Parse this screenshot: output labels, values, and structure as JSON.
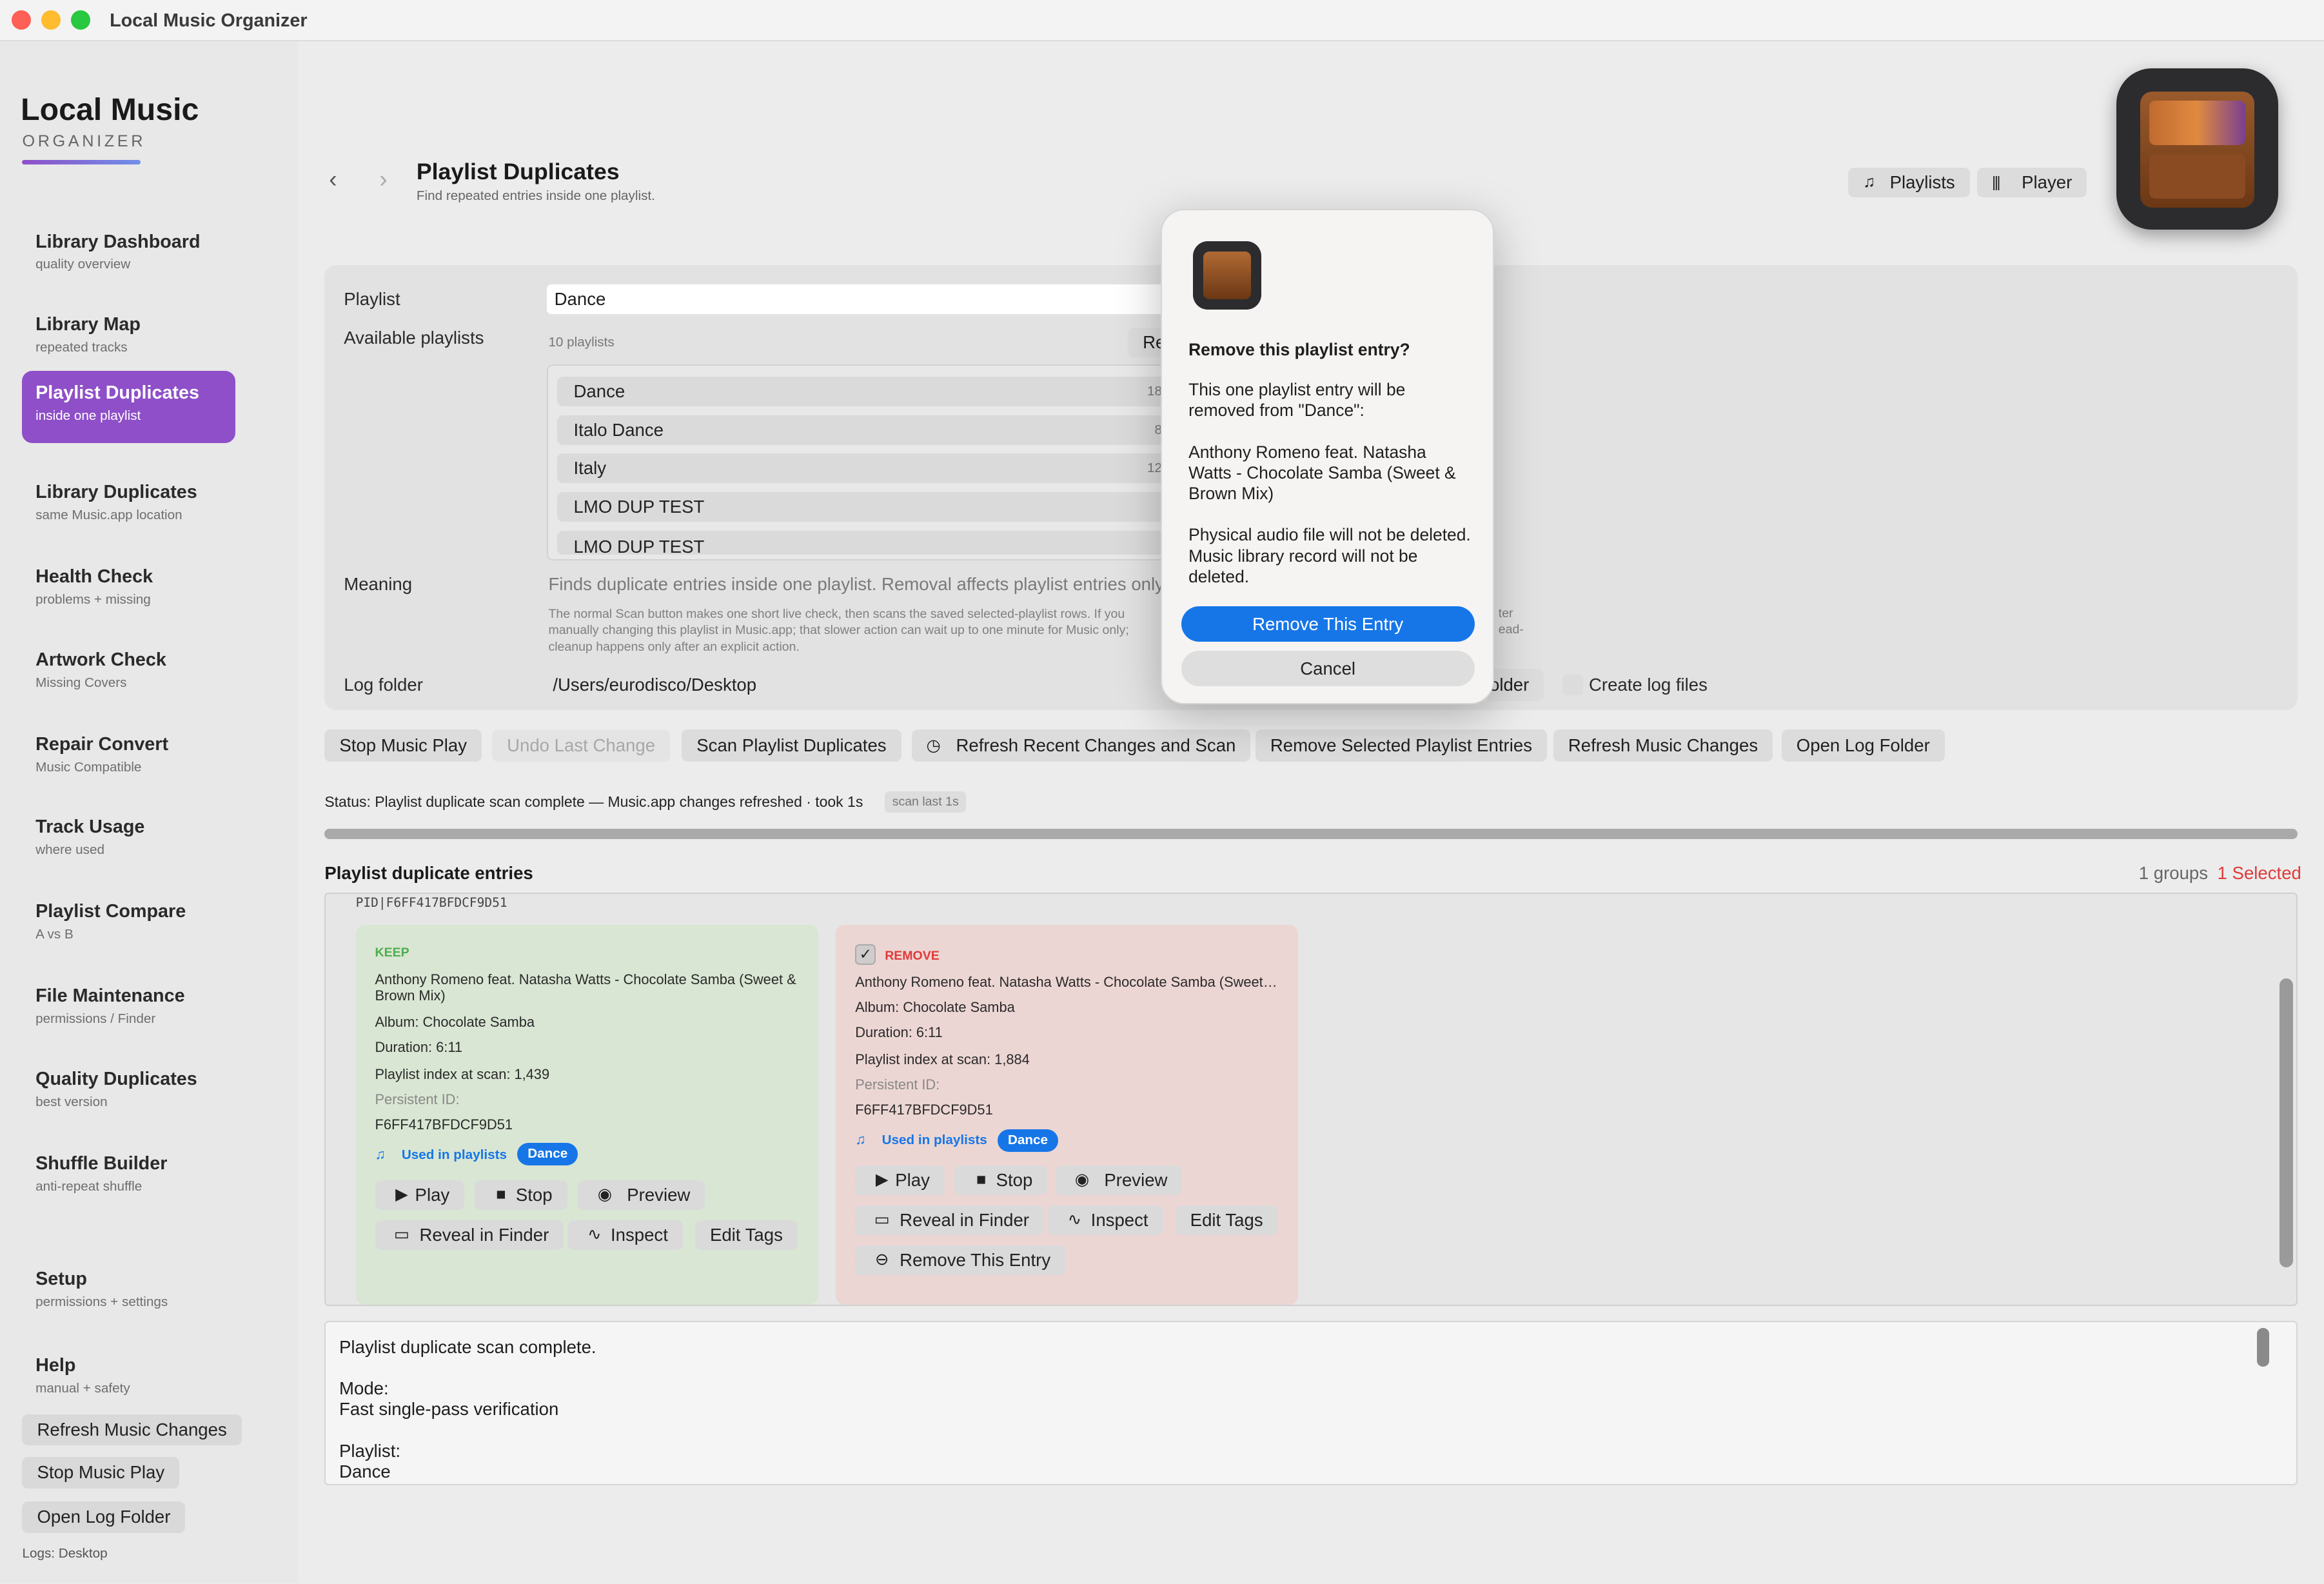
{
  "window": {
    "title": "Local Music Organizer"
  },
  "sidebar": {
    "brand_title": "Local Music",
    "brand_subtitle": "ORGANIZER",
    "items": [
      {
        "label": "Library Dashboard",
        "sub": "quality overview"
      },
      {
        "label": "Library Map",
        "sub": "repeated tracks"
      },
      {
        "label": "Playlist Duplicates",
        "sub": "inside one playlist"
      },
      {
        "label": "Library Duplicates",
        "sub": "same Music.app location"
      },
      {
        "label": "Health Check",
        "sub": "problems + missing"
      },
      {
        "label": "Artwork Check",
        "sub": "Missing Covers"
      },
      {
        "label": "Repair Convert",
        "sub": "Music Compatible"
      },
      {
        "label": "Track Usage",
        "sub": "where used"
      },
      {
        "label": "Playlist Compare",
        "sub": "A vs B"
      },
      {
        "label": "File Maintenance",
        "sub": "permissions / Finder"
      },
      {
        "label": "Quality Duplicates",
        "sub": "best version"
      },
      {
        "label": "Shuffle Builder",
        "sub": "anti-repeat shuffle"
      },
      {
        "label": "Setup",
        "sub": "permissions + settings"
      },
      {
        "label": "Help",
        "sub": "manual + safety"
      }
    ],
    "buttons": [
      "Refresh Music Changes",
      "Stop Music Play",
      "Open Log Folder"
    ],
    "logs": "Logs: Desktop"
  },
  "header": {
    "title": "Playlist Duplicates",
    "subtitle": "Find repeated entries inside one playlist.",
    "playlists_btn": "Playlists",
    "player_btn": "Player"
  },
  "form": {
    "playlist_label": "Playlist",
    "playlist_value": "Dance",
    "available_label": "Available playlists",
    "count": "10 playlists",
    "refresh_partial": "Re",
    "playlists": [
      {
        "name": "Dance",
        "count": "18"
      },
      {
        "name": "Italo Dance",
        "count": "8"
      },
      {
        "name": "Italy",
        "count": "12"
      },
      {
        "name": "LMO DUP TEST",
        "count": ""
      },
      {
        "name": "LMO DUP TEST",
        "count": ""
      }
    ],
    "meaning_label": "Meaning",
    "meaning_text": "Finds duplicate entries inside one playlist. Removal affects playlist entries only,",
    "meaning_small": "The normal Scan button makes one short live check, then scans the saved selected-playlist rows. If you manually changing this playlist in Music.app; that slower action can wait up to one minute for Music only; cleanup happens only after an explicit action.",
    "meaning_small_right1": "ter",
    "meaning_small_right2": "ead-",
    "log_label": "Log folder",
    "log_value": "/Users/eurodisco/Desktop",
    "log_btn_partial": "older",
    "create_log": "Create log files"
  },
  "toolbar": {
    "stop": "Stop Music Play",
    "undo": "Undo Last Change",
    "scan": "Scan Playlist Duplicates",
    "refresh_scan": "Refresh Recent Changes and Scan",
    "remove_selected": "Remove Selected Playlist Entries",
    "refresh_changes": "Refresh Music Changes",
    "open_log": "Open Log Folder"
  },
  "status": {
    "text": "Status: Playlist duplicate scan complete — Music.app changes refreshed · took 1s",
    "badge": "scan last 1s"
  },
  "entries": {
    "title": "Playlist duplicate entries",
    "groups": "1 groups",
    "selected": "1 Selected",
    "pid": "PID|F6FF417BFDCF9D51",
    "keep": {
      "tag": "KEEP",
      "title": "Anthony Romeno feat. Natasha Watts - Chocolate Samba (Sweet & Brown Mix)",
      "album": "Album: Chocolate Samba",
      "duration": "Duration: 6:11",
      "index": "Playlist index at scan: 1,439",
      "pid_label": "Persistent ID:",
      "pid": "F6FF417BFDCF9D51",
      "used": "Used in playlists",
      "pill": "Dance"
    },
    "remove": {
      "tag": "REMOVE",
      "title": "Anthony Romeno feat. Natasha Watts - Chocolate Samba (Sweet…",
      "album": "Album: Chocolate Samba",
      "duration": "Duration: 6:11",
      "index": "Playlist index at scan: 1,884",
      "pid_label": "Persistent ID:",
      "pid": "F6FF417BFDCF9D51",
      "used": "Used in playlists",
      "pill": "Dance",
      "remove_btn": "Remove This Entry"
    },
    "btns": {
      "play": "Play",
      "stop": "Stop",
      "preview": "Preview",
      "reveal": "Reveal in Finder",
      "inspect": "Inspect",
      "edit": "Edit Tags"
    }
  },
  "log": {
    "line1": "Playlist duplicate scan complete.",
    "line2": "Mode:",
    "line3": "Fast single-pass verification",
    "line4": "Playlist:",
    "line5": "Dance"
  },
  "dialog": {
    "title": "Remove this playlist entry?",
    "p1": "This one playlist entry will be removed from \"Dance\":",
    "p2": "Anthony Romeno feat. Natasha Watts - Chocolate Samba (Sweet & Brown Mix)",
    "p3": "Physical audio file will not be deleted. Music library record will not be deleted.",
    "confirm": "Remove This Entry",
    "cancel": "Cancel"
  },
  "colors": {
    "accent": "#8e4fc8",
    "blue": "#1676e8",
    "keep": "#d9e6d3",
    "remove": "#ecd6d3",
    "danger": "#e03a3a"
  }
}
